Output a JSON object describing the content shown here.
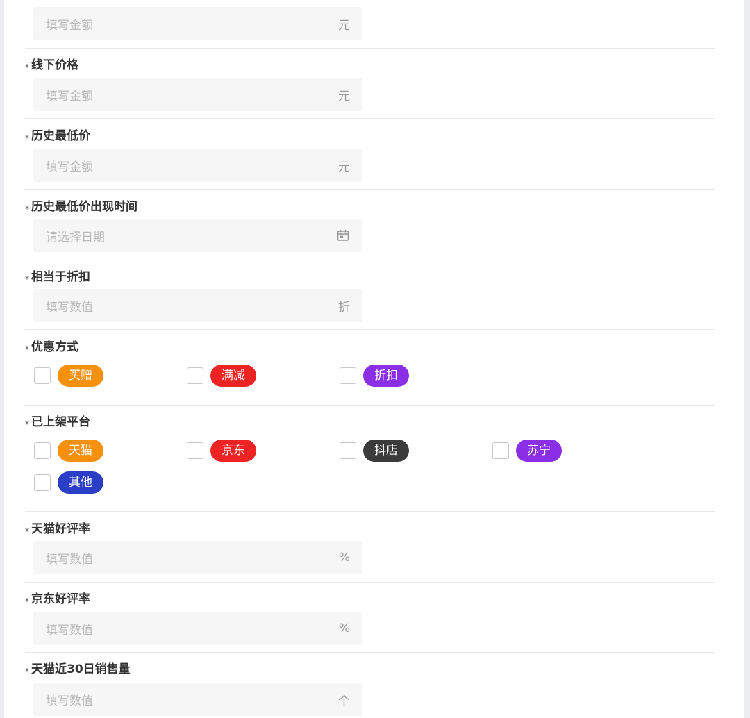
{
  "fields": {
    "online_price": {
      "placeholder": "填写金额",
      "unit": "元"
    },
    "offline_price": {
      "label": "线下价格",
      "placeholder": "填写金额",
      "unit": "元"
    },
    "lowest_price": {
      "label": "历史最低价",
      "placeholder": "填写金额",
      "unit": "元"
    },
    "lowest_price_time": {
      "label": "历史最低价出现时间",
      "placeholder": "请选择日期",
      "icon": "calendar-icon"
    },
    "discount": {
      "label": "相当于折扣",
      "placeholder": "填写数值",
      "unit": "折"
    },
    "tmall_rating": {
      "label": "天猫好评率",
      "placeholder": "填写数值",
      "unit": "%"
    },
    "jd_rating": {
      "label": "京东好评率",
      "placeholder": "填写数值",
      "unit": "%"
    },
    "tmall_sales": {
      "label": "天猫近30日销售量",
      "placeholder": "填写数值",
      "unit": "个"
    }
  },
  "required_mark": "*",
  "promotion": {
    "label": "优惠方式",
    "options": [
      {
        "label": "买赠",
        "color": "#f7900d"
      },
      {
        "label": "满减",
        "color": "#ee2323"
      },
      {
        "label": "折扣",
        "color": "#8a2fe6"
      }
    ]
  },
  "platforms": {
    "label": "已上架平台",
    "options": [
      {
        "label": "天猫",
        "color": "#f7900d"
      },
      {
        "label": "京东",
        "color": "#ee2323"
      },
      {
        "label": "抖店",
        "color": "#3b3b3b"
      },
      {
        "label": "苏宁",
        "color": "#8a2fe6"
      },
      {
        "label": "其他",
        "color": "#2b3fc6"
      }
    ]
  }
}
